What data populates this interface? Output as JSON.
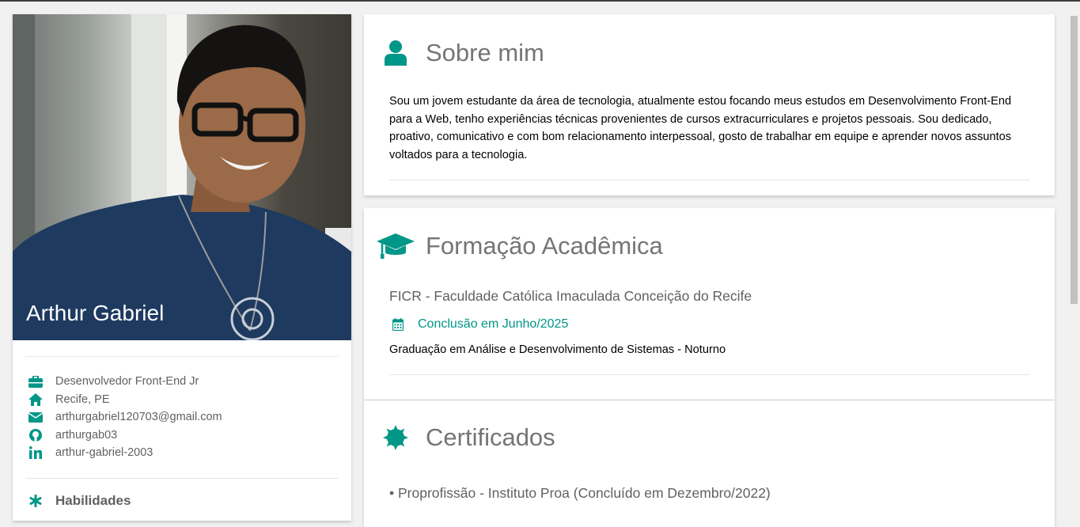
{
  "profile": {
    "name": "Arthur Gabriel",
    "details": [
      {
        "icon": "briefcase-icon",
        "text": "Desenvolvedor Front-End Jr"
      },
      {
        "icon": "home-icon",
        "text": "Recife, PE"
      },
      {
        "icon": "envelope-icon",
        "text": "arthurgabriel120703@gmail.com"
      },
      {
        "icon": "github-icon",
        "text": "arthurgab03"
      },
      {
        "icon": "linkedin-icon",
        "text": "arthur-gabriel-2003"
      }
    ],
    "skills_label": "Habilidades"
  },
  "about": {
    "title": "Sobre mim",
    "text": "Sou um jovem estudante da área de tecnologia, atualmente estou focando meus estudos em Desenvolvimento Front-End para a Web, tenho experiências técnicas provenientes de cursos extracurriculares e projetos pessoais. Sou dedicado, proativo, comunicativo e com bom relacionamento interpessoal, gosto de trabalhar em equipe e aprender novos assuntos voltados para a tecnologia."
  },
  "education": {
    "title": "Formação Acadêmica",
    "school": "FICR - Faculdade Católica Imaculada Conceição do Recife",
    "date": "Conclusão em Junho/2025",
    "course": "Graduação em Análise e Desenvolvimento de Sistemas - Noturno"
  },
  "certificates": {
    "title": "Certificados",
    "items": [
      "• Proprofissão - Instituto Proa (Concluído em Dezembro/2022)"
    ]
  },
  "colors": {
    "accent": "#009688",
    "text_muted": "#757575",
    "background": "#f1f1f1"
  }
}
